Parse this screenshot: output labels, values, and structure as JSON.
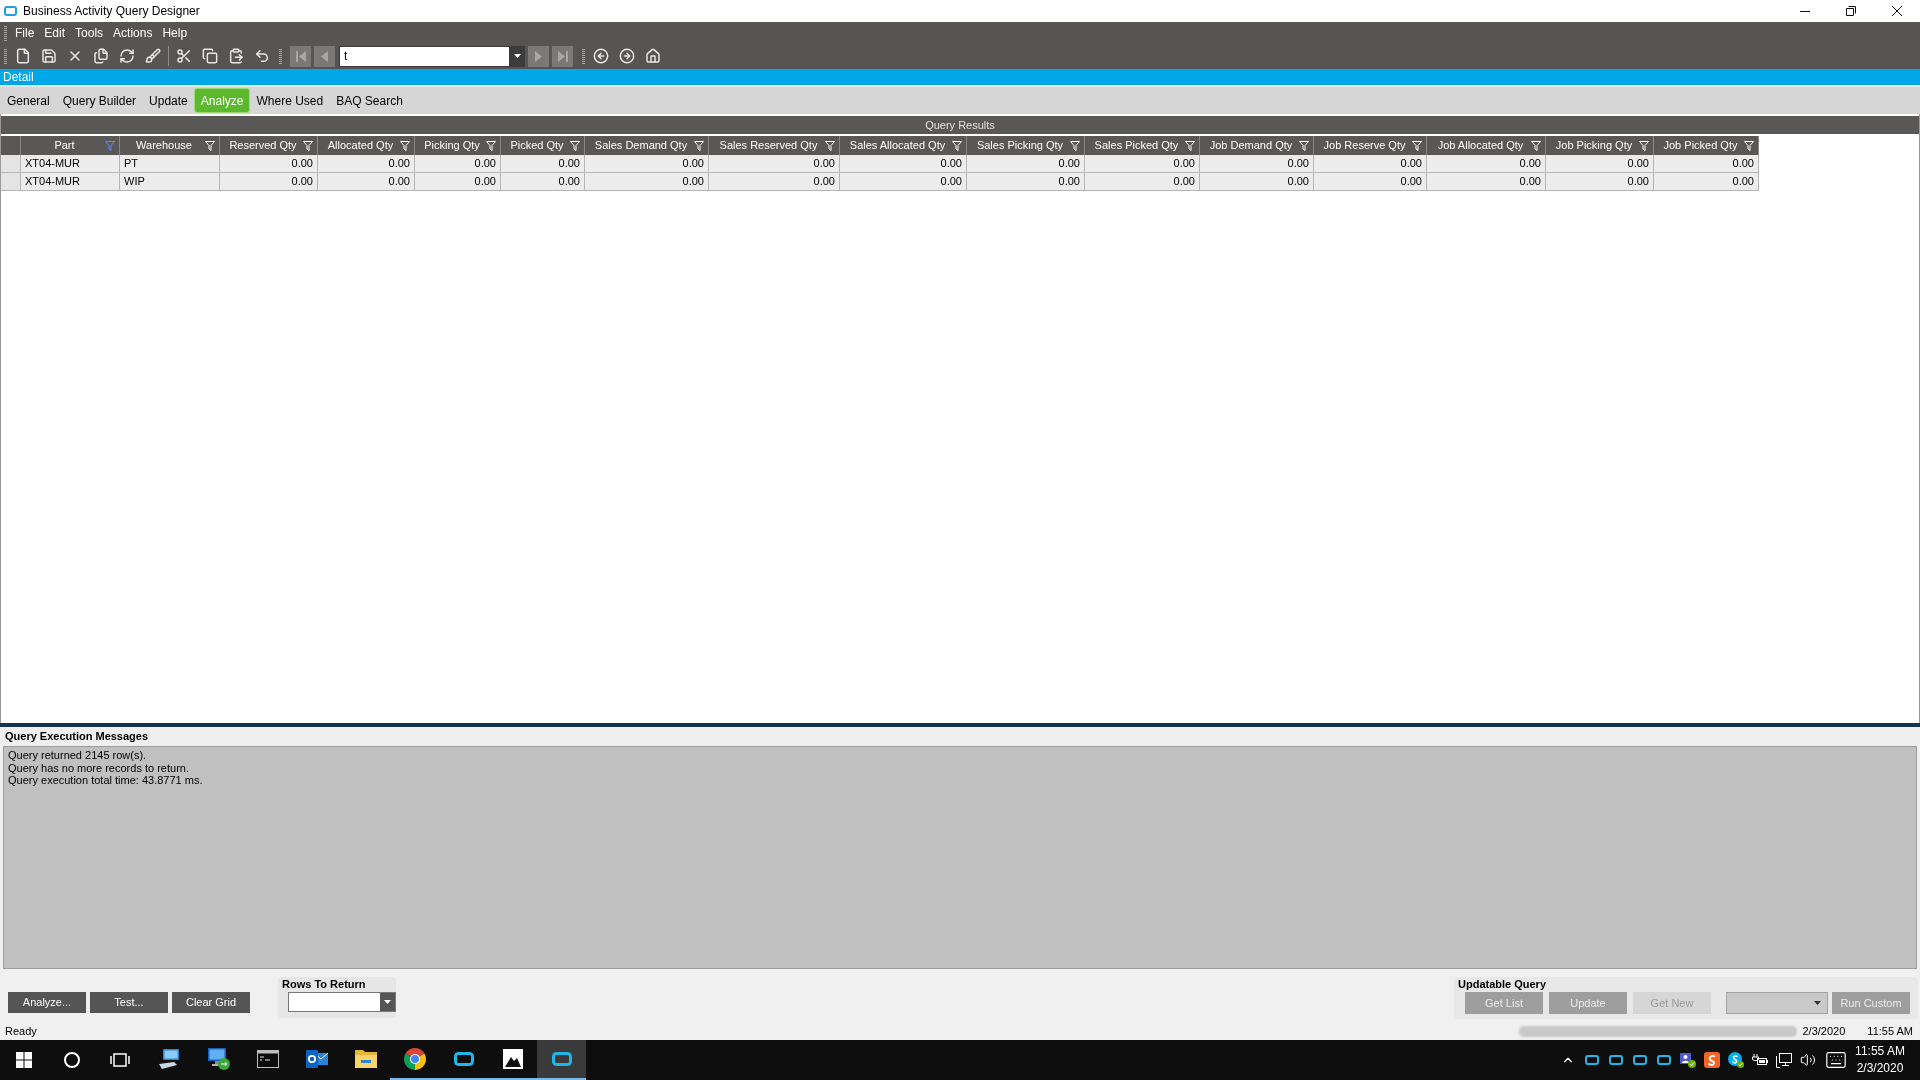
{
  "window": {
    "title": "Business Activity Query Designer"
  },
  "menu": [
    "File",
    "Edit",
    "Tools",
    "Actions",
    "Help"
  ],
  "toolbar": {
    "record_field": {
      "value": "t"
    }
  },
  "panel": {
    "title": "Detail"
  },
  "tabs": [
    {
      "label": "General",
      "selected": false
    },
    {
      "label": "Query Builder",
      "selected": false
    },
    {
      "label": "Update",
      "selected": false
    },
    {
      "label": "Analyze",
      "selected": true
    },
    {
      "label": "Where Used",
      "selected": false
    },
    {
      "label": "BAQ Search",
      "selected": false
    }
  ],
  "results": {
    "title": "Query Results",
    "columns": [
      {
        "label": "Part",
        "filtered": true
      },
      {
        "label": "Warehouse",
        "filtered": false
      },
      {
        "label": "Reserved Qty",
        "filtered": false
      },
      {
        "label": "Allocated Qty",
        "filtered": false
      },
      {
        "label": "Picking Qty",
        "filtered": false
      },
      {
        "label": "Picked Qty",
        "filtered": false
      },
      {
        "label": "Sales Demand Qty",
        "filtered": false
      },
      {
        "label": "Sales Reserved Qty",
        "filtered": false
      },
      {
        "label": "Sales Allocated Qty",
        "filtered": false
      },
      {
        "label": "Sales Picking Qty",
        "filtered": false
      },
      {
        "label": "Sales Picked Qty",
        "filtered": false
      },
      {
        "label": "Job Demand Qty",
        "filtered": false
      },
      {
        "label": "Job Reserve Qty",
        "filtered": false
      },
      {
        "label": "Job Allocated Qty",
        "filtered": false
      },
      {
        "label": "Job Picking Qty",
        "filtered": false
      },
      {
        "label": "Job Picked Qty",
        "filtered": false
      }
    ],
    "rows": [
      {
        "cells": [
          "XT04-MUR",
          "PT",
          "0.00",
          "0.00",
          "0.00",
          "0.00",
          "0.00",
          "0.00",
          "0.00",
          "0.00",
          "0.00",
          "0.00",
          "0.00",
          "0.00",
          "0.00",
          "0.00"
        ]
      },
      {
        "cells": [
          "XT04-MUR",
          "WIP",
          "0.00",
          "0.00",
          "0.00",
          "0.00",
          "0.00",
          "0.00",
          "0.00",
          "0.00",
          "0.00",
          "0.00",
          "0.00",
          "0.00",
          "0.00",
          "0.00"
        ]
      }
    ]
  },
  "messages": {
    "title": "Query Execution Messages",
    "lines": [
      "Query returned 2145 row(s).",
      "Query has no more records to return.",
      "Query execution total time: 43.8771 ms."
    ]
  },
  "query_buttons": [
    "Analyze...",
    "Test...",
    "Clear Grid"
  ],
  "rows_to_return": {
    "label": "Rows To Return"
  },
  "updatable_query": {
    "title": "Updatable Query",
    "controls": [
      {
        "kind": "button",
        "label": "Get List",
        "disabled": true
      },
      {
        "kind": "button",
        "label": "Update",
        "disabled": true
      },
      {
        "kind": "light-button",
        "label": "Get New",
        "disabled": true
      },
      {
        "kind": "dropdown",
        "disabled": true
      },
      {
        "kind": "button",
        "label": "Run Custom",
        "disabled": true
      }
    ]
  },
  "status_bar": {
    "text": "Ready",
    "date": "2/3/2020",
    "time": "11:55 AM"
  },
  "taskbar": {
    "apps": [
      {
        "kind": "computer",
        "running": false,
        "selected": false
      },
      {
        "kind": "remote-desktop",
        "running": false,
        "selected": false
      },
      {
        "kind": "terminal",
        "running": false,
        "selected": false
      },
      {
        "kind": "mail",
        "running": false,
        "selected": false
      },
      {
        "kind": "folder",
        "running": false,
        "selected": false
      },
      {
        "kind": "browser",
        "running": true,
        "selected": false
      },
      {
        "kind": "app",
        "running": true,
        "selected": false
      },
      {
        "kind": "photos",
        "running": true,
        "selected": false
      },
      {
        "kind": "app",
        "running": true,
        "selected": true
      }
    ],
    "clock": {
      "time": "11:55 AM",
      "date": "2/3/2020"
    }
  }
}
